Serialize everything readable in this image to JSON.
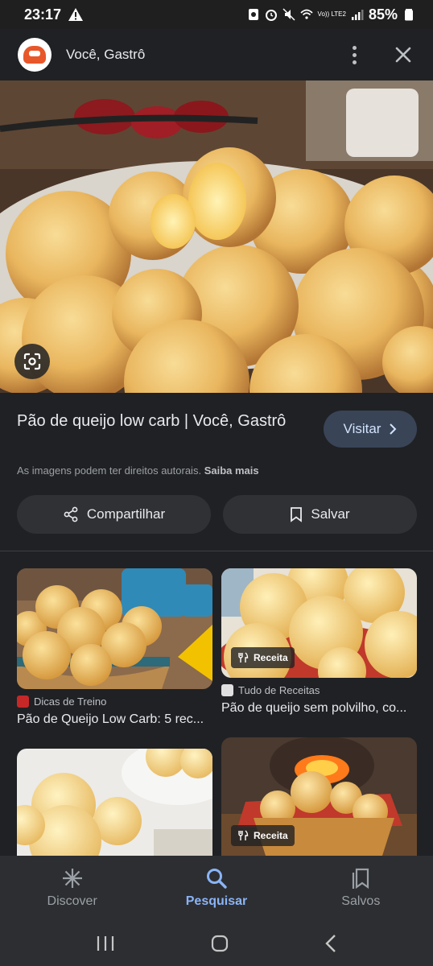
{
  "status_bar": {
    "time": "23:17",
    "network_label": "Vo)) LTE2",
    "battery": "85%"
  },
  "header": {
    "site_name": "Você, Gastrô",
    "more_icon": "more-vert-icon",
    "close_icon": "close-icon"
  },
  "result": {
    "title": "Pão de queijo low carb | Você, Gastrô",
    "visit_label": "Visitar",
    "copyright_text": "As imagens podem ter direitos autorais.",
    "learn_more": "Saiba mais",
    "share_label": "Compartilhar",
    "save_label": "Salvar"
  },
  "related": [
    {
      "source": "Dicas de Treino",
      "title": "Pão de Queijo Low Carb: 5 rec...",
      "chip": ""
    },
    {
      "source": "Tudo de Receitas",
      "title": "Pão de queijo sem polvilho, co...",
      "chip": "Receita"
    },
    {
      "source": "",
      "title": "",
      "chip": ""
    },
    {
      "source": "",
      "title": "",
      "chip": "Receita"
    }
  ],
  "bottom_nav": [
    {
      "label": "Discover",
      "icon": "asterisk-icon",
      "active": false
    },
    {
      "label": "Pesquisar",
      "icon": "search-icon",
      "active": true
    },
    {
      "label": "Salvos",
      "icon": "bookmarks-icon",
      "active": false
    }
  ],
  "colors": {
    "background": "#202124",
    "accent": "#8ab4f8",
    "visit_button": "#394457"
  }
}
